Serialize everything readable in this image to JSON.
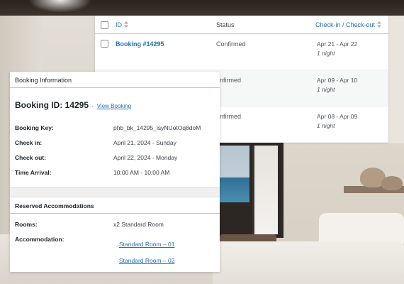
{
  "list": {
    "columns": {
      "id": "ID",
      "status": "Status",
      "check": "Check-in / Check-out"
    },
    "rows": [
      {
        "id": "Booking #14295",
        "status": "Confirmed",
        "dates": "Apr 21 - Apr 22",
        "nights": "1 night"
      },
      {
        "id": "",
        "status": "onfirmed",
        "dates": "Apr 09 - Apr 10",
        "nights": "1 night"
      },
      {
        "id": "",
        "status": "onfirmed",
        "dates": "Apr 08 - Apr 09",
        "nights": "1 night"
      }
    ]
  },
  "panel": {
    "title": "Booking Information",
    "booking_id": "Booking ID: 14295",
    "separator": "-",
    "view_link": "View Booking",
    "fields": [
      {
        "label": "Booking Key:",
        "value": "phb_bk_14295_isyNUotOq8doM"
      },
      {
        "label": "Check in:",
        "value": "April 21, 2024 - Sunday"
      },
      {
        "label": "Check out:",
        "value": "April 22, 2024 - Monday"
      },
      {
        "label": "Time Arrival:",
        "value": "10:00 AM - 10:00 AM"
      }
    ],
    "reserved": {
      "title": "Reserved Accommodations",
      "rooms_label": "Rooms:",
      "rooms_value": "x2 Standard Room",
      "accommodation_label": "Accommodation:",
      "accommodations": [
        "Standard Room – 01",
        "Standard Room – 02"
      ]
    }
  },
  "colors": {
    "link": "#2271b1",
    "border": "#c3c4c7",
    "text": "#3c434a"
  },
  "icons": {
    "sort": "sort-arrows-icon",
    "checkbox": "checkbox-icon"
  }
}
